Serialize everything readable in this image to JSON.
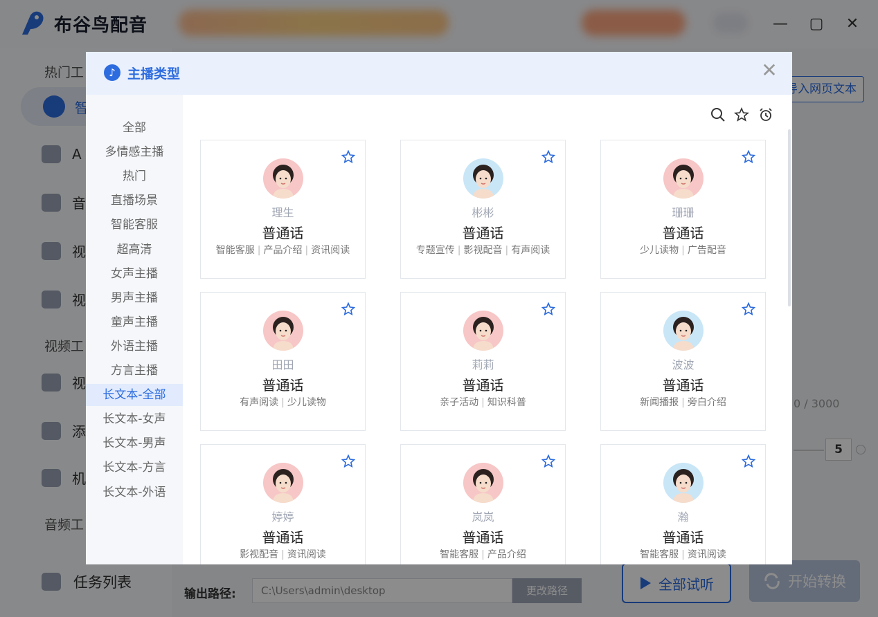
{
  "app": {
    "name": "布谷鸟配音",
    "colors": {
      "primary": "#2d6cdf",
      "overlay": "rgba(0,0,0,0.45)"
    }
  },
  "window_controls": {
    "minimize": "—",
    "maximize": "▢",
    "close": "✕"
  },
  "sidebar": {
    "group_hot": "热门工",
    "active_item": "智",
    "items": [
      "A",
      "音",
      "视",
      "视"
    ],
    "group_video": "视频工",
    "video_items": [
      "视",
      "添",
      "机"
    ],
    "group_audio": "音频工",
    "task_list": "任务列表"
  },
  "main": {
    "import_web_text": "导入网页文本",
    "char_count": "0 / 3000",
    "speed_value": "5",
    "output_path_label": "输出路径:",
    "output_path_value": "C:\\Users\\admin\\desktop",
    "change_path": "更改路径",
    "preview_all": "全部试听",
    "start_convert": "开始转换"
  },
  "modal": {
    "title": "主播类型",
    "close_icon": "close-icon",
    "categories": [
      "全部",
      "多情感主播",
      "热门",
      "直播场景",
      "智能客服",
      "超高清",
      "女声主播",
      "男声主播",
      "童声主播",
      "外语主播",
      "方言主播",
      "长文本-全部",
      "长文本-女声",
      "长文本-男声",
      "长文本-方言",
      "长文本-外语"
    ],
    "active_category_index": 11,
    "toolbar_icons": [
      "search-icon",
      "star-icon",
      "alarm-clock-icon"
    ],
    "voices": [
      {
        "name": "理生",
        "lang": "普通话",
        "tags": [
          "智能客服",
          "产品介绍",
          "资讯阅读"
        ],
        "avatar_color": "#f7c6c6"
      },
      {
        "name": "彬彬",
        "lang": "普通话",
        "tags": [
          "专题宣传",
          "影视配音",
          "有声阅读"
        ],
        "avatar_color": "#c9e6f7"
      },
      {
        "name": "珊珊",
        "lang": "普通话",
        "tags": [
          "少儿读物",
          "广告配音"
        ],
        "avatar_color": "#f7c6c6"
      },
      {
        "name": "田田",
        "lang": "普通话",
        "tags": [
          "有声阅读",
          "少儿读物"
        ],
        "avatar_color": "#f7c6c6"
      },
      {
        "name": "莉莉",
        "lang": "普通话",
        "tags": [
          "亲子活动",
          "知识科普"
        ],
        "avatar_color": "#f7c6c6"
      },
      {
        "name": "波波",
        "lang": "普通话",
        "tags": [
          "新闻播报",
          "旁白介绍"
        ],
        "avatar_color": "#c9e6f7"
      },
      {
        "name": "婷婷",
        "lang": "普通话",
        "tags": [
          "影视配音",
          "资讯阅读"
        ],
        "avatar_color": "#f7c6c6"
      },
      {
        "name": "岚岚",
        "lang": "普通话",
        "tags": [
          "智能客服",
          "产品介绍"
        ],
        "avatar_color": "#f7c6c6"
      },
      {
        "name": "瀚",
        "lang": "普通话",
        "tags": [
          "智能客服",
          "资讯阅读"
        ],
        "avatar_color": "#c9e6f7"
      }
    ]
  }
}
